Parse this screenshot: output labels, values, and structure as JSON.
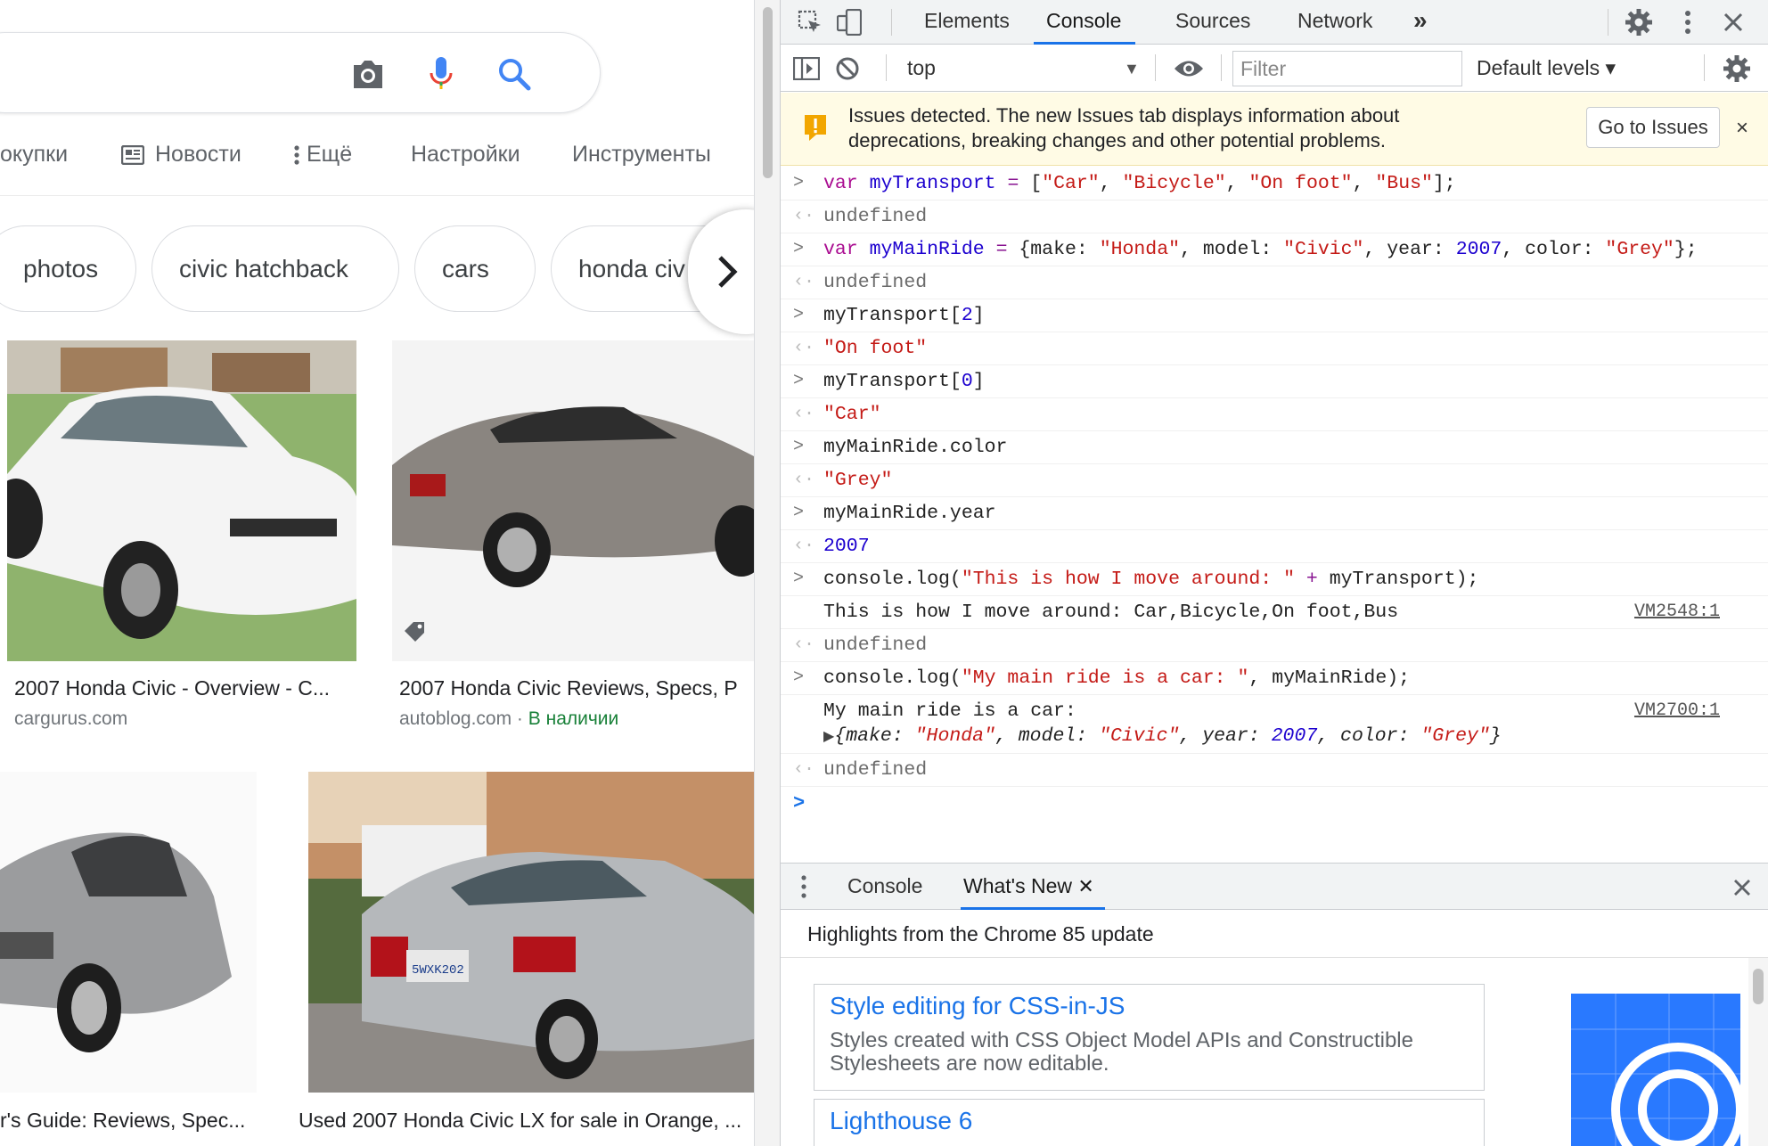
{
  "google": {
    "tabs": [
      "окупки",
      "Новости",
      "Ещё",
      "Настройки",
      "Инструменты"
    ],
    "chips": [
      "photos",
      "civic hatchback",
      "cars",
      "honda civ"
    ],
    "results": [
      {
        "title": "2007 Honda Civic - Overview - C...",
        "source": "cargurus.com",
        "availability": ""
      },
      {
        "title": "2007 Honda Civic Reviews, Specs, P",
        "source": "autoblog.com",
        "availability": "В наличии"
      },
      {
        "title": "r's Guide: Reviews, Spec...",
        "source": "",
        "availability": ""
      },
      {
        "title": "Used 2007 Honda Civic LX for sale in Orange, ...",
        "source": "",
        "availability": ""
      }
    ],
    "plate_text": "5WXK202"
  },
  "devtools": {
    "tabs": [
      "Elements",
      "Console",
      "Sources",
      "Network"
    ],
    "more_tabs": "»",
    "context": "top",
    "filter_placeholder": "Filter",
    "levels": "Default levels ▾",
    "issues": {
      "text": "Issues detected. The new Issues tab displays information about deprecations, breaking changes and other potential problems.",
      "button": "Go to Issues",
      "close": "×"
    },
    "console": {
      "undefined": "undefined",
      "out_transport2": "\"On foot\"",
      "out_transport0": "\"Car\"",
      "out_color": "\"Grey\"",
      "out_year": "2007",
      "log1_text": "This is how I move around: Car,Bicycle,On foot,Bus",
      "log1_link": "VM2548:1",
      "log2_text": "My main ride is a car:",
      "log2_link": "VM2700:1"
    },
    "drawer": {
      "tabs": [
        "Console",
        "What's New"
      ],
      "header": "Highlights from the Chrome 85 update",
      "cards": [
        {
          "title": "Style editing for CSS-in-JS",
          "desc": "Styles created with CSS Object Model APIs and Constructible Stylesheets are now editable."
        },
        {
          "title": "Lighthouse 6",
          "desc": ""
        }
      ]
    },
    "colors": {
      "accent": "#1a73e8",
      "string": "#c41a16",
      "keyword": "#aa0d91",
      "number": "#1c00cf"
    }
  }
}
